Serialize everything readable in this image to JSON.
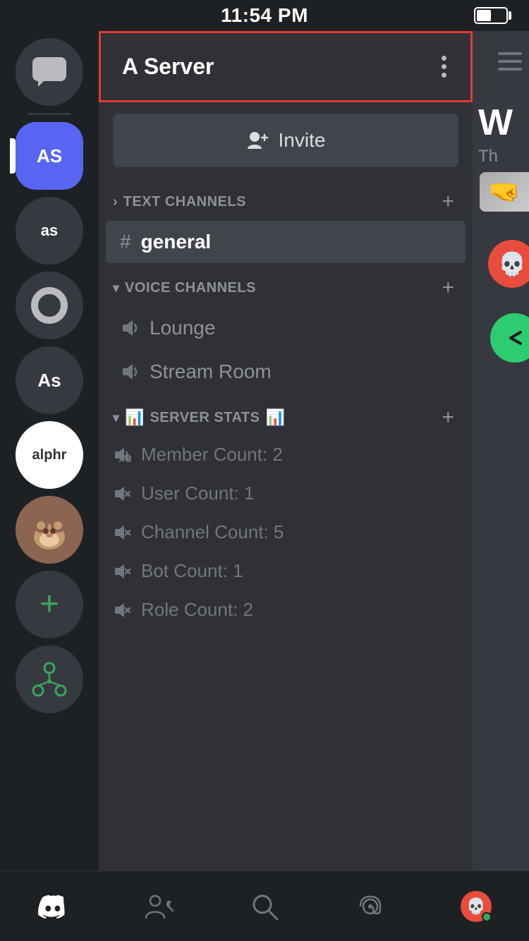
{
  "statusBar": {
    "time": "11:54 PM"
  },
  "serverList": {
    "items": [
      {
        "id": "messages",
        "type": "messages",
        "label": ""
      },
      {
        "id": "as-blue",
        "type": "as-blue",
        "label": "AS"
      },
      {
        "id": "as-dark",
        "type": "as-dark",
        "label": "as"
      },
      {
        "id": "ring",
        "type": "ring",
        "label": ""
      },
      {
        "id": "as-server",
        "type": "as-server",
        "label": "As"
      },
      {
        "id": "alphr",
        "type": "alphr",
        "label": "alphr"
      },
      {
        "id": "add",
        "type": "add",
        "label": "+"
      },
      {
        "id": "discovery",
        "type": "discovery",
        "label": ""
      }
    ]
  },
  "channelPanel": {
    "serverName": "A Server",
    "moreOptionsLabel": "...",
    "inviteLabel": "Invite",
    "textChannels": {
      "sectionTitle": "TEXT CHANNELS",
      "addLabel": "+",
      "chevron": "›",
      "channels": [
        {
          "id": "general",
          "name": "general",
          "active": true
        }
      ]
    },
    "voiceChannels": {
      "sectionTitle": "VOICE CHANNELS",
      "addLabel": "+",
      "chevron": "˅",
      "channels": [
        {
          "id": "lounge",
          "name": "Lounge"
        },
        {
          "id": "stream-room",
          "name": "Stream Room"
        }
      ]
    },
    "serverStats": {
      "sectionTitle": "SERVER STATS",
      "sectionTitleEmoji": "📊",
      "addLabel": "+",
      "chevron": "˅",
      "stats": [
        {
          "id": "member-count",
          "name": "Member Count: 2"
        },
        {
          "id": "user-count",
          "name": "User Count: 1"
        },
        {
          "id": "channel-count",
          "name": "Channel Count: 5"
        },
        {
          "id": "bot-count",
          "name": "Bot Count: 1"
        },
        {
          "id": "role-count",
          "name": "Role Count: 2"
        }
      ]
    }
  },
  "rightPanel": {
    "heading": "W",
    "subtext": "Th"
  },
  "bottomNav": {
    "items": [
      {
        "id": "discord",
        "icon": "discord",
        "label": "Discord"
      },
      {
        "id": "friends",
        "icon": "friends",
        "label": "Friends"
      },
      {
        "id": "search",
        "icon": "search",
        "label": "Search"
      },
      {
        "id": "mentions",
        "icon": "mentions",
        "label": "Mentions"
      },
      {
        "id": "profile",
        "icon": "profile",
        "label": "Profile"
      }
    ]
  }
}
